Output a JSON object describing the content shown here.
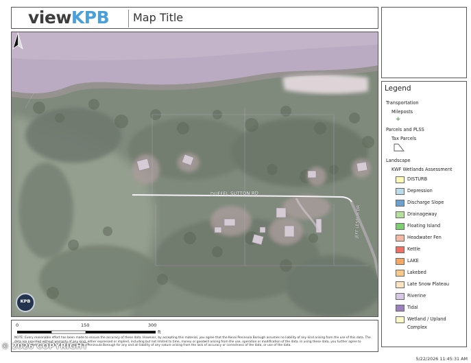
{
  "header": {
    "logo_part1": "view",
    "logo_part2": "KPB",
    "map_title": "Map Title"
  },
  "map": {
    "road_label": "DUFFEL SUTTON RD",
    "road_label_side": "JEFF LESEUR DR",
    "badge": "KPB",
    "north_arrow_icon": "north-arrow-icon"
  },
  "legend": {
    "title": "Legend",
    "groups": [
      {
        "label": "Transportation",
        "sub": "Mileposts",
        "icon": "plus-marker-icon"
      },
      {
        "label": "Parcels and PLSS",
        "sub": "Tax Parcels",
        "icon": "parcel-polygon-icon"
      },
      {
        "label": "Landscape",
        "sub": "KWF Wetlands Assessment",
        "icon": ""
      }
    ],
    "wetlands": [
      {
        "label": "DISTURB",
        "color": "#fefcb8"
      },
      {
        "label": "Depression",
        "color": "#bcdbe8"
      },
      {
        "label": "Discharge Slope",
        "color": "#6d9fcc"
      },
      {
        "label": "Drainageway",
        "color": "#b4df9c"
      },
      {
        "label": "Floating Island",
        "color": "#7fcd72"
      },
      {
        "label": "Headwater Fen",
        "color": "#f3b8a6"
      },
      {
        "label": "Kettle",
        "color": "#ee7169"
      },
      {
        "label": "LAKE",
        "color": "#f6a766"
      },
      {
        "label": "Lakebed",
        "color": "#f9c98a"
      },
      {
        "label": "Late Snow Plateau",
        "color": "#fde3c0"
      },
      {
        "label": "Riverine",
        "color": "#d8c8e4"
      },
      {
        "label": "Tidal",
        "color": "#9a80bf"
      },
      {
        "label": "Wetland / Upland",
        "label2": "Complex",
        "color": "#fdfcc8"
      }
    ]
  },
  "scale": {
    "ticks": [
      "0",
      "150",
      "300"
    ],
    "unit": "ft"
  },
  "note": "NOTE: Every reasonable effort has been made to ensure the accuracy of these data. However, by accepting this material, you agree that the Kenai Peninsula Borough assumes no liability of any kind arising from the use of this data. The data are provided without warranty of any kind, either expressed or implied, including but not limited to time, money or goodwill arising from the use, operation or modification of the data. In using these data, you further agree to indemnify, defend, and hold harmless the Kenai Peninsula Borough for any and all liability of any nature arising from the lack of accuracy or correctness of the data, or use of the data.",
  "copyright": "© 2026 COPYRIGHT",
  "timestamp": "5/22/2026 11:45:31 AM"
}
